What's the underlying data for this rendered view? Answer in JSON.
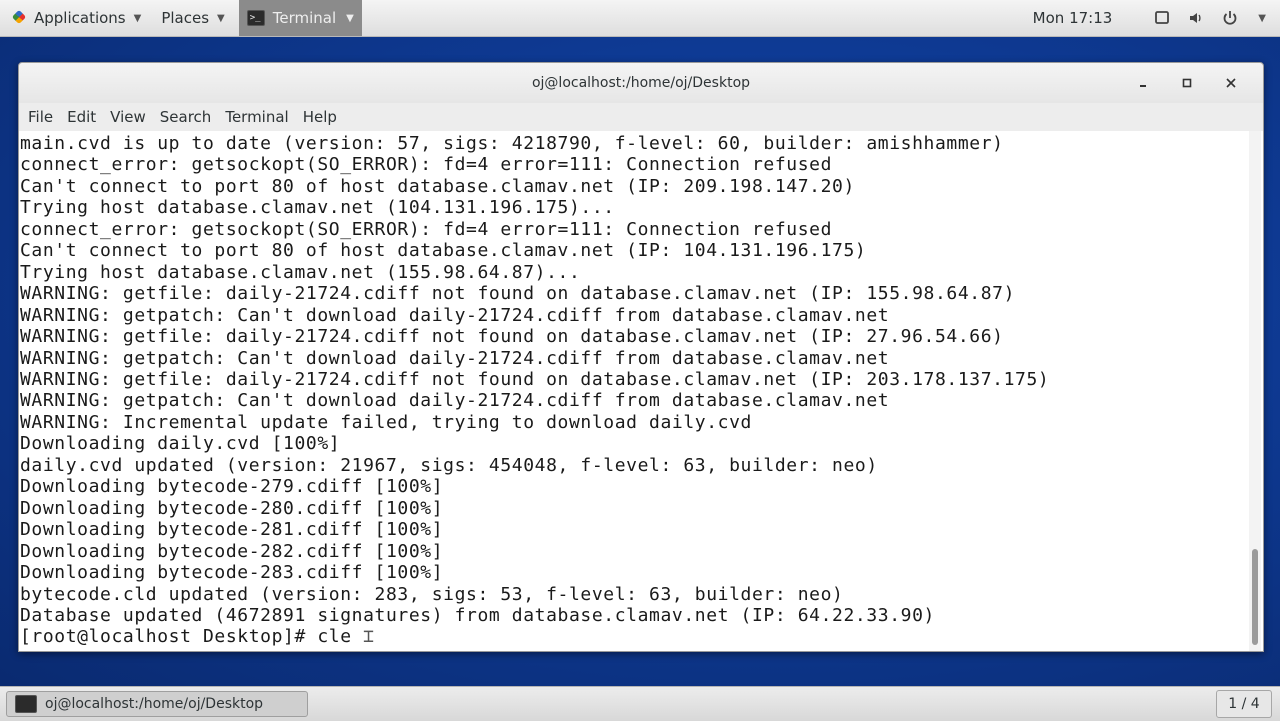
{
  "top_panel": {
    "applications_label": "Applications",
    "places_label": "Places",
    "terminal_task_label": "Terminal",
    "clock": "Mon 17:13"
  },
  "window": {
    "title": "oj@localhost:/home/oj/Desktop",
    "menu": [
      "File",
      "Edit",
      "View",
      "Search",
      "Terminal",
      "Help"
    ]
  },
  "terminal": {
    "lines": [
      "main.cvd is up to date (version: 57, sigs: 4218790, f-level: 60, builder: amishhammer)",
      "connect_error: getsockopt(SO_ERROR): fd=4 error=111: Connection refused",
      "Can't connect to port 80 of host database.clamav.net (IP: 209.198.147.20)",
      "Trying host database.clamav.net (104.131.196.175)...",
      "connect_error: getsockopt(SO_ERROR): fd=4 error=111: Connection refused",
      "Can't connect to port 80 of host database.clamav.net (IP: 104.131.196.175)",
      "Trying host database.clamav.net (155.98.64.87)...",
      "WARNING: getfile: daily-21724.cdiff not found on database.clamav.net (IP: 155.98.64.87)",
      "WARNING: getpatch: Can't download daily-21724.cdiff from database.clamav.net",
      "WARNING: getfile: daily-21724.cdiff not found on database.clamav.net (IP: 27.96.54.66)",
      "WARNING: getpatch: Can't download daily-21724.cdiff from database.clamav.net",
      "WARNING: getfile: daily-21724.cdiff not found on database.clamav.net (IP: 203.178.137.175)",
      "WARNING: getpatch: Can't download daily-21724.cdiff from database.clamav.net",
      "WARNING: Incremental update failed, trying to download daily.cvd",
      "Downloading daily.cvd [100%]",
      "daily.cvd updated (version: 21967, sigs: 454048, f-level: 63, builder: neo)",
      "Downloading bytecode-279.cdiff [100%]",
      "Downloading bytecode-280.cdiff [100%]",
      "Downloading bytecode-281.cdiff [100%]",
      "Downloading bytecode-282.cdiff [100%]",
      "Downloading bytecode-283.cdiff [100%]",
      "bytecode.cld updated (version: 283, sigs: 53, f-level: 63, builder: neo)",
      "Database updated (4672891 signatures) from database.clamav.net (IP: 64.22.33.90)"
    ],
    "prompt": "[root@localhost Desktop]# ",
    "input": "cle"
  },
  "bottom_panel": {
    "task_label": "oj@localhost:/home/oj/Desktop",
    "workspace": "1 / 4"
  }
}
